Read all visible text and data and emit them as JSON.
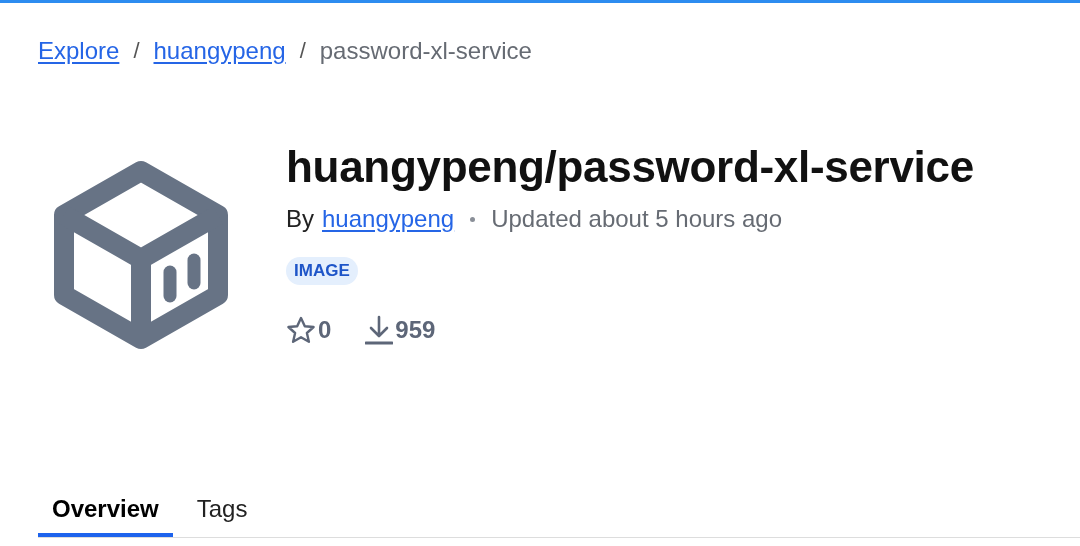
{
  "breadcrumb_separator": "/",
  "breadcrumb": [
    {
      "label": "Explore",
      "kind": "link"
    },
    {
      "label": "huangypeng",
      "kind": "link"
    },
    {
      "label": "password-xl-service",
      "kind": "current"
    }
  ],
  "repo": {
    "title": "huangypeng/password-xl-service",
    "by_label": "By",
    "author": "huangypeng",
    "updated": "Updated about 5 hours ago",
    "badge": "IMAGE",
    "stars": "0",
    "downloads": "959"
  },
  "tabs": [
    {
      "label": "Overview",
      "selected": true
    },
    {
      "label": "Tags",
      "selected": false
    }
  ]
}
